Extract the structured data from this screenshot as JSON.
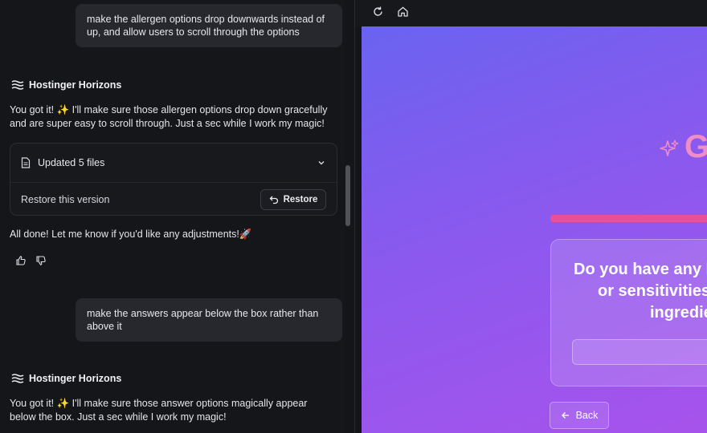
{
  "chat": {
    "messages": [
      {
        "role": "user",
        "text": "make the allergen options drop downwards instead of up, and allow users to scroll through the options"
      },
      {
        "role": "assistant",
        "author": "Hostinger Horizons",
        "text": "You got it! ✨ I'll make sure those allergen options drop down gracefully and are super easy to scroll through. Just a sec while I work my magic!"
      },
      {
        "role": "user",
        "text": "make the answers appear below the box rather than above it"
      },
      {
        "role": "assistant",
        "author": "Hostinger Horizons",
        "text": "You got it! ✨ I'll make sure those answer options magically appear below the box. Just a sec while I work my magic!"
      }
    ],
    "files_card": {
      "updated_label": "Updated 5 files",
      "restore_label": "Restore this version",
      "restore_button": "Restore"
    },
    "done_text": "All done! Let me know if you'd like any adjustments!🚀"
  },
  "preview": {
    "title_fragment": "G",
    "question_lines": [
      "Do you have any k",
      "or sensitivities",
      "ingredie"
    ],
    "back_button": "Back",
    "colors": {
      "gradient_start": "#6a63f0",
      "gradient_end": "#a753ec",
      "accent_pink": "#e8509a",
      "title_pink": "#f08cc7"
    }
  },
  "icons": [
    "brand-waves-icon",
    "file-icon",
    "chevron-down-icon",
    "undo-icon",
    "thumbs-up-icon",
    "thumbs-down-icon",
    "reload-icon",
    "home-icon",
    "sparkle-icon",
    "arrow-left-icon"
  ]
}
